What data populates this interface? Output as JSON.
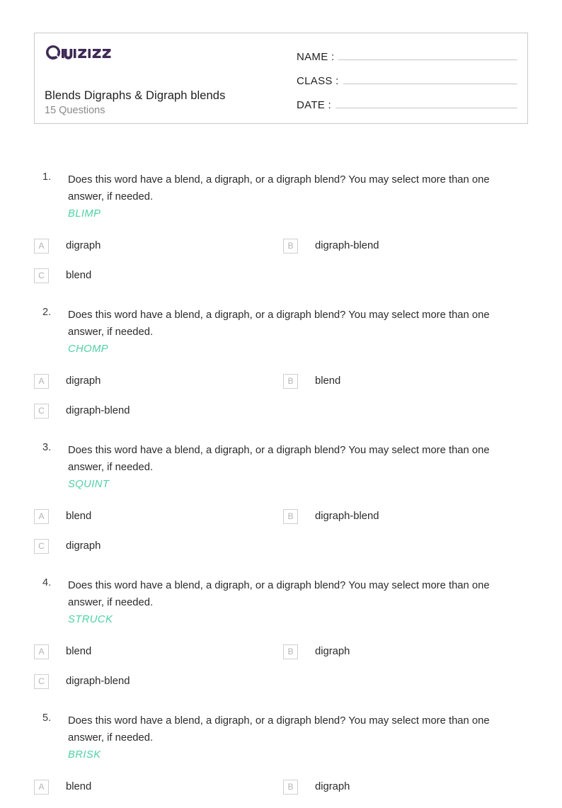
{
  "header": {
    "logo_text": "Quizizz",
    "logo_color": "#3f2a56",
    "title": "Blends Digraphs & Digraph blends",
    "subtitle": "15 Questions",
    "fields": [
      {
        "label": "NAME :",
        "value": ""
      },
      {
        "label": "CLASS :",
        "value": ""
      },
      {
        "label": "DATE  :",
        "value": ""
      }
    ]
  },
  "accent_color": "#4fd1a5",
  "questions": [
    {
      "number": "1.",
      "prompt": "Does this word have a blend, a digraph, or a digraph blend? You may select more than one answer, if needed.",
      "word": "BLIMP",
      "options": [
        {
          "letter": "A",
          "text": "digraph"
        },
        {
          "letter": "B",
          "text": "digraph-blend"
        },
        {
          "letter": "C",
          "text": "blend"
        }
      ]
    },
    {
      "number": "2.",
      "prompt": "Does this word have a blend, a digraph, or a digraph blend? You may select more than one answer, if needed.",
      "word": "CHOMP",
      "options": [
        {
          "letter": "A",
          "text": "digraph"
        },
        {
          "letter": "B",
          "text": "blend"
        },
        {
          "letter": "C",
          "text": "digraph-blend"
        }
      ]
    },
    {
      "number": "3.",
      "prompt": "Does this word have a blend, a digraph, or a digraph blend? You may select more than one answer, if needed.",
      "word": "SQUINT",
      "options": [
        {
          "letter": "A",
          "text": "blend"
        },
        {
          "letter": "B",
          "text": "digraph-blend"
        },
        {
          "letter": "C",
          "text": "digraph"
        }
      ]
    },
    {
      "number": "4.",
      "prompt": "Does this word have a blend, a digraph, or a digraph blend? You may select more than one answer, if needed.",
      "word": "STRUCK",
      "options": [
        {
          "letter": "A",
          "text": "blend"
        },
        {
          "letter": "B",
          "text": "digraph"
        },
        {
          "letter": "C",
          "text": "digraph-blend"
        }
      ]
    },
    {
      "number": "5.",
      "prompt": "Does this word have a blend, a digraph, or a digraph blend? You may select more than one answer, if needed.",
      "word": "BRISK",
      "options": [
        {
          "letter": "A",
          "text": "blend"
        },
        {
          "letter": "B",
          "text": "digraph"
        }
      ]
    }
  ]
}
